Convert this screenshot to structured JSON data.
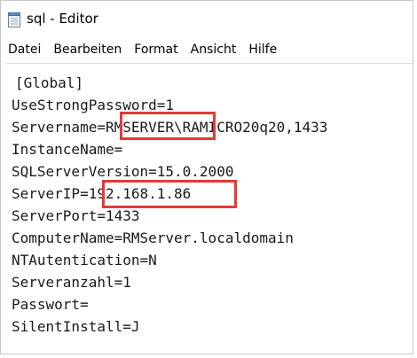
{
  "window": {
    "title": "sql - Editor"
  },
  "menu": [
    "Datei",
    "Bearbeiten",
    "Format",
    "Ansicht",
    "Hilfe"
  ],
  "editor": {
    "lines": [
      "[Global]",
      "UseStrongPassword=1",
      "Servername=RMSERVER\\RAMICRO20q20,1433",
      "InstanceName=",
      "SQLServerVersion=15.0.2000",
      "ServerIP=192.168.1.86",
      "ServerPort=1433",
      "ComputerName=RMServer.localdomain",
      "NTAutentication=N",
      "Serveranzahl=1",
      "Passwort=",
      "SilentInstall=J"
    ]
  },
  "colors": {
    "highlight": "#e53935"
  }
}
